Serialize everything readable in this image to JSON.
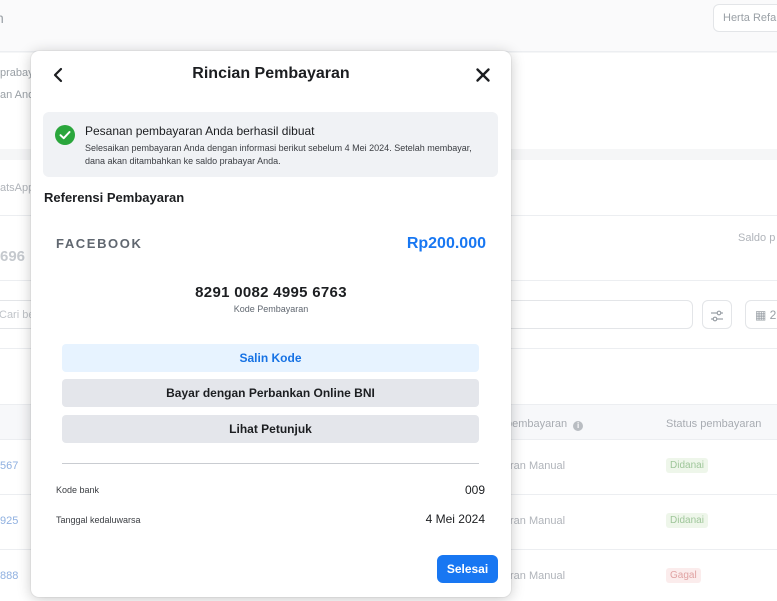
{
  "background": {
    "account_button": "Herta Refa",
    "nav_fragment": "n",
    "panel1_line1": "prabaya",
    "panel1_line2": "an Anda",
    "whatsapp_fragment": "atsApp",
    "balance_fragment": "696",
    "saldo_fragment": "Saldo p",
    "search_placeholder": "Cari be",
    "calendar_fragment": "▦ 2",
    "table": {
      "header_method": "pembayaran",
      "header_status": "Status pembayaran",
      "rows": [
        {
          "id": "567",
          "method": "ran Manual",
          "status": "Didanai"
        },
        {
          "id": "925",
          "method": "ran Manual",
          "status": "Didanai"
        },
        {
          "id": "888",
          "method": "ran Manual",
          "status": "Gagal"
        }
      ]
    }
  },
  "modal": {
    "title": "Rincian Pembayaran",
    "alert": {
      "title": "Pesanan pembayaran Anda berhasil dibuat",
      "body": "Selesaikan pembayaran Anda dengan informasi berikut sebelum 4 Mei 2024. Setelah membayar, dana akan ditambahkan ke saldo prabayar Anda."
    },
    "reference_title": "Referensi Pembayaran",
    "brand": "FACEBOOK",
    "amount": "Rp200.000",
    "payment_code": "8291 0082 4995 6763",
    "payment_code_label": "Kode Pembayaran",
    "buttons": {
      "copy": "Salin Kode",
      "bank": "Bayar dengan Perbankan Online BNI",
      "guide": "Lihat Petunjuk"
    },
    "details": {
      "bank_code_label": "Kode bank",
      "bank_code_value": "009",
      "expiry_label": "Tanggal kedaluwarsa",
      "expiry_value": "4 Mei 2024"
    },
    "done_button": "Selesai"
  },
  "colors": {
    "primary": "#1877f2",
    "success": "#2aa63c",
    "secondary_button": "#e4e6eb",
    "copy_button_bg": "#e7f3ff"
  }
}
